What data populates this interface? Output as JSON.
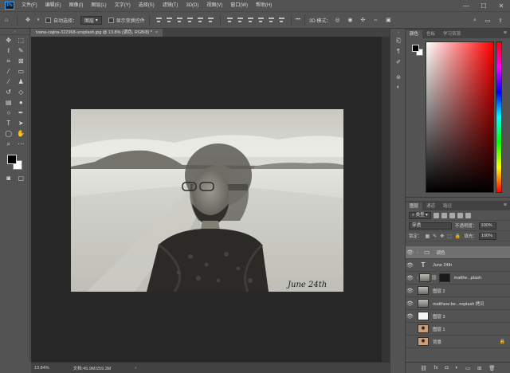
{
  "app": {
    "logo": "Ps"
  },
  "menu": [
    "文件(F)",
    "编辑(E)",
    "图像(I)",
    "图层(L)",
    "文字(Y)",
    "选择(S)",
    "滤镜(T)",
    "3D(D)",
    "视图(V)",
    "窗口(W)",
    "帮助(H)"
  ],
  "window_controls": [
    "—",
    "☐",
    "✕"
  ],
  "options": {
    "auto_select_label": "自动选择：",
    "auto_select_value": "图层",
    "show_transform_label": "显示变换控件",
    "more": "•••",
    "mode_3d": "3D 模式："
  },
  "document": {
    "tab_title": "ivana-cajina-322968-unsplash.jpg @ 13.8% (调色, RGB/8) *",
    "close": "×",
    "artwork_text": "June 24th"
  },
  "status": {
    "zoom": "13.84%",
    "doc_size": "文档:45.9M/259.3M",
    "arrow": "›"
  },
  "color_panel": {
    "tabs": [
      "颜色",
      "色板",
      "学习资源"
    ],
    "fg_color": "#000000",
    "bg_color": "#ffffff"
  },
  "layers_panel": {
    "tabs": [
      "图层",
      "通道",
      "路径"
    ],
    "filter_label": "类型",
    "blend_mode": "穿透",
    "opacity_label": "不透明度：",
    "opacity_value": "100%",
    "lock_label": "锁定：",
    "fill_label": "填充：",
    "fill_value": "100%",
    "layers": [
      {
        "name": "调色",
        "type": "folder",
        "selected": true
      },
      {
        "name": "June 24th",
        "type": "text"
      },
      {
        "name": "matthe...plash",
        "type": "photo-mask"
      },
      {
        "name": "图层 2",
        "type": "photo"
      },
      {
        "name": "matthew-be...nsplash 拷贝",
        "type": "photo"
      },
      {
        "name": "图层 3",
        "type": "white"
      },
      {
        "name": "图层 1",
        "type": "portrait"
      },
      {
        "name": "背景",
        "type": "portrait",
        "locked": true
      }
    ],
    "footer_icons": [
      "link-icon",
      "fx-icon",
      "mask-icon",
      "adjustment-icon",
      "group-icon",
      "new-layer-icon",
      "trash-icon"
    ]
  }
}
